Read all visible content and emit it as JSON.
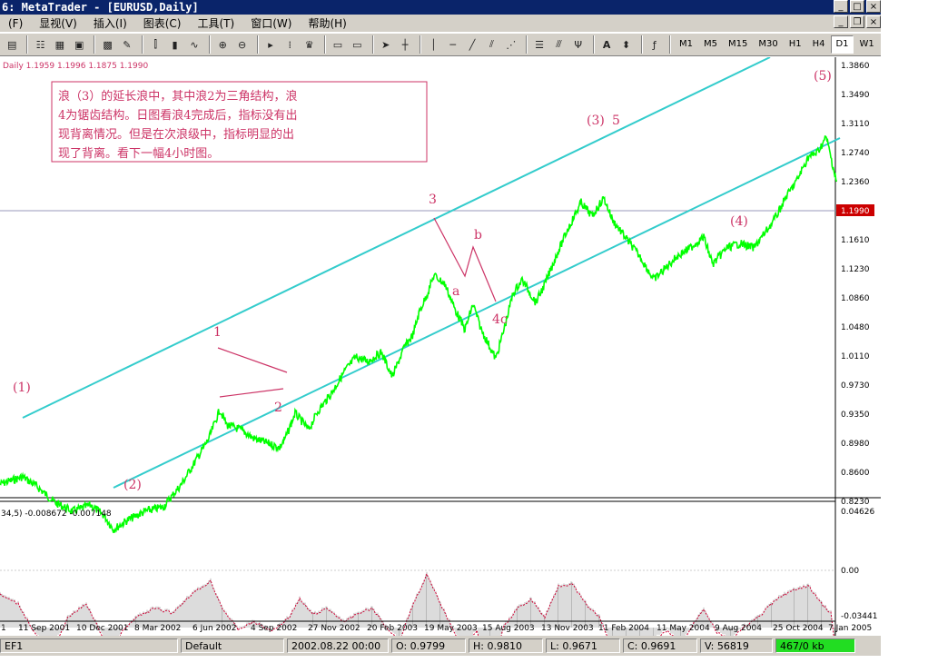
{
  "window": {
    "title": "6: MetaTrader - [EURUSD,Daily]"
  },
  "menu": [
    "(F)",
    "显视(V)",
    "插入(I)",
    "图表(C)",
    "工具(T)",
    "窗口(W)",
    "帮助(H)"
  ],
  "timeframes": [
    "M1",
    "M5",
    "M15",
    "M30",
    "H1",
    "H4",
    "D1",
    "W1"
  ],
  "active_timeframe": "D1",
  "chart_header": "Daily  1.1959 1.1996 1.1875 1.1990",
  "price_axis": [
    "1.3860",
    "1.3490",
    "1.3110",
    "1.2740",
    "1.2360",
    "1.1990",
    "1.1610",
    "1.1230",
    "1.0860",
    "1.0480",
    "1.0110",
    "0.9730",
    "0.9350",
    "0.8980",
    "0.8600",
    "0.8230"
  ],
  "current_price": "1.1990",
  "indicator_header": "34,5)  -0.008672  -0.007148",
  "indicator_axis": [
    "0.04626",
    "0.00",
    "-0.03441"
  ],
  "date_axis": [
    "1",
    "11 Sep 2001",
    "10 Dec 2001",
    "8 Mar 2002",
    "6 Jun 2002",
    "4 Sep 2002",
    "27 Nov 2002",
    "20 Feb 2003",
    "19 May 2003",
    "15 Aug 2003",
    "13 Nov 2003",
    "11 Feb 2004",
    "11 May 2004",
    "9 Aug 2004",
    "25 Oct 2004",
    "7 Jan 2005"
  ],
  "annotation_box": [
    "浪（3）的延长浪中，其中浪2为三角结构，浪",
    "4为锯齿结构。日图看浪4完成后，指标没有出",
    "现背离情况。但是在次浪级中，指标明显的出",
    "现了背离。看下一幅4小时图。"
  ],
  "wave_labels": {
    "w1": "(1)",
    "w2": "(2)",
    "w3": "(3)",
    "w4": "(4)",
    "w5": "(5)",
    "s1": "1",
    "s2": "2",
    "s3": "3",
    "s4": "4",
    "s5": "5",
    "a": "a",
    "b": "b",
    "c": "c"
  },
  "status": {
    "profile": "EF1",
    "template": "Default",
    "datetime": "2002.08.22 00:00",
    "open": "O: 0.9799",
    "high": "H: 0.9810",
    "low": "L: 0.9671",
    "close": "C: 0.9691",
    "volume": "V: 56819",
    "traffic": "467/0 kb"
  },
  "colors": {
    "price": "#00ff00",
    "channel": "#33cccc",
    "annotation": "#cc3366",
    "indicator_line": "#cc0033",
    "histogram": "#b0b0b0",
    "traffic": "#00e000"
  }
}
